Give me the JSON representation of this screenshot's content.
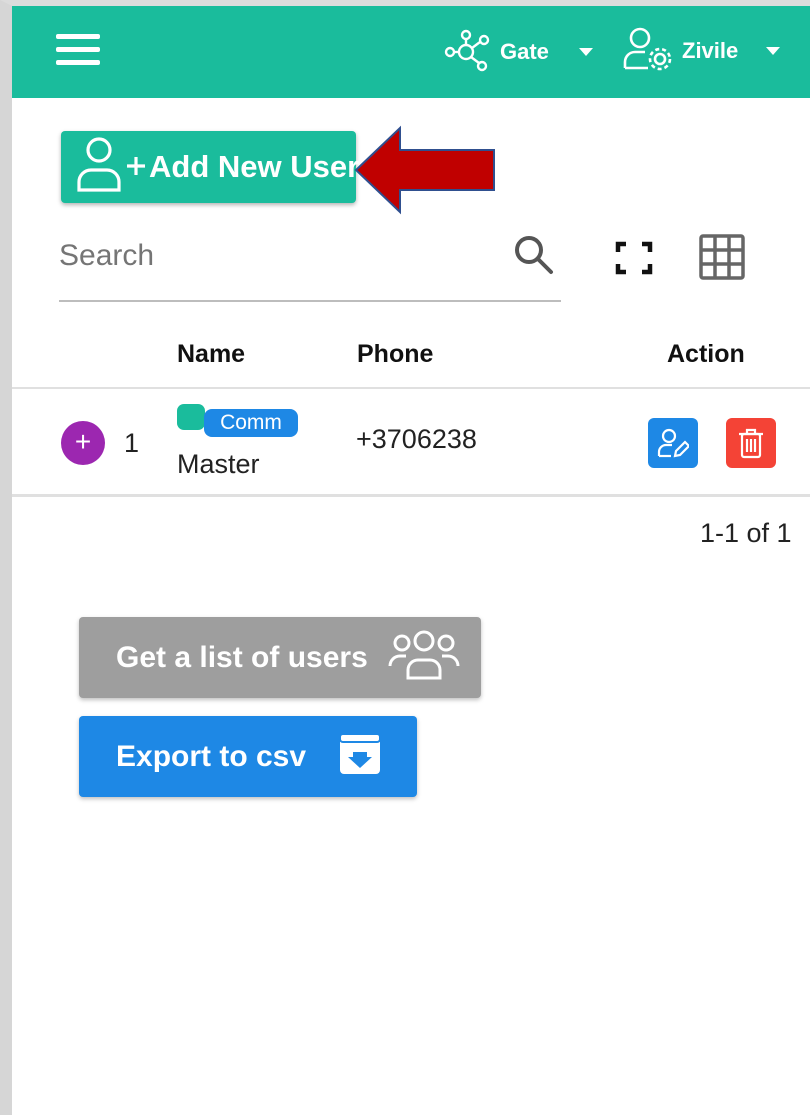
{
  "topbar": {
    "gate_label": "Gate",
    "user_label": "Zivile",
    "bg_color": "#1abc9c"
  },
  "toolbar": {
    "add_user_label": "Add New User",
    "search_placeholder": "Search"
  },
  "table": {
    "headers": [
      "Name",
      "Phone",
      "Action"
    ],
    "rows": [
      {
        "index": "1",
        "badge": "Comm",
        "name": "Master",
        "phone": "+3706238"
      }
    ]
  },
  "pagination": {
    "range": "1-1 of 1"
  },
  "actions": {
    "list_users_label": "Get a list of users",
    "export_label": "Export to csv"
  },
  "icons": {
    "menu": "hamburger-icon",
    "gate": "network-icon",
    "user": "user-settings-icon",
    "add": "user-plus-icon",
    "search": "search-icon",
    "fullscreen": "fullscreen-icon",
    "columns": "grid-icon",
    "edit": "user-edit-icon",
    "delete": "trash-icon",
    "users": "users-group-icon",
    "export": "download-box-icon"
  },
  "colors": {
    "accent": "#1abc9c",
    "primary": "#1e88e5",
    "danger": "#f44336",
    "expand": "#9c27b0",
    "secondary": "#9e9e9e",
    "annotation_arrow": "#c00000"
  }
}
